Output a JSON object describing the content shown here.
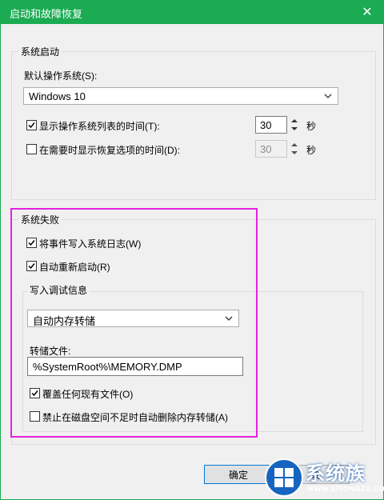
{
  "window": {
    "title": "启动和故障恢复",
    "close_glyph": "✕"
  },
  "system_startup": {
    "group_label": "系统启动",
    "default_os_label": "默认操作系统(S):",
    "default_os_value": "Windows 10",
    "show_list": {
      "checked": true,
      "label": "显示操作系统列表的时间(T):",
      "value": "30",
      "unit": "秒"
    },
    "show_recovery": {
      "checked": false,
      "label": "在需要时显示恢复选项的时间(D):",
      "value": "30",
      "unit": "秒",
      "disabled": true
    }
  },
  "system_failure": {
    "group_label": "系统失败",
    "write_event_log": {
      "checked": true,
      "label": "将事件写入系统日志(W)"
    },
    "auto_restart": {
      "checked": true,
      "label": "自动重新启动(R)"
    },
    "debug_info": {
      "group_label": "写入调试信息",
      "dump_type": "自动内存转储",
      "dump_file_label": "转储文件:",
      "dump_file_value": "%SystemRoot%\\MEMORY.DMP",
      "overwrite": {
        "checked": true,
        "label": "覆盖任何现有文件(O)"
      },
      "disable_auto_delete": {
        "checked": false,
        "label": "禁止在磁盘空间不足时自动删除内存转储(A)"
      }
    }
  },
  "buttons": {
    "ok": "确定",
    "cancel_partial": "取"
  },
  "watermark": {
    "brand": "系统族",
    "url": "WWW.XITONGZU.COM"
  },
  "colors": {
    "titlebar": "#1aab53",
    "highlight": "#e521e0",
    "dialog_bg": "#f0f0f0",
    "button_border": "#0078d7"
  },
  "icons": {
    "close": "close-icon",
    "dropdown": "chevron-down-icon",
    "checkbox": "checkmark-icon",
    "spinner": "spinner-arrows-icon",
    "logo": "windows-logo-icon"
  }
}
